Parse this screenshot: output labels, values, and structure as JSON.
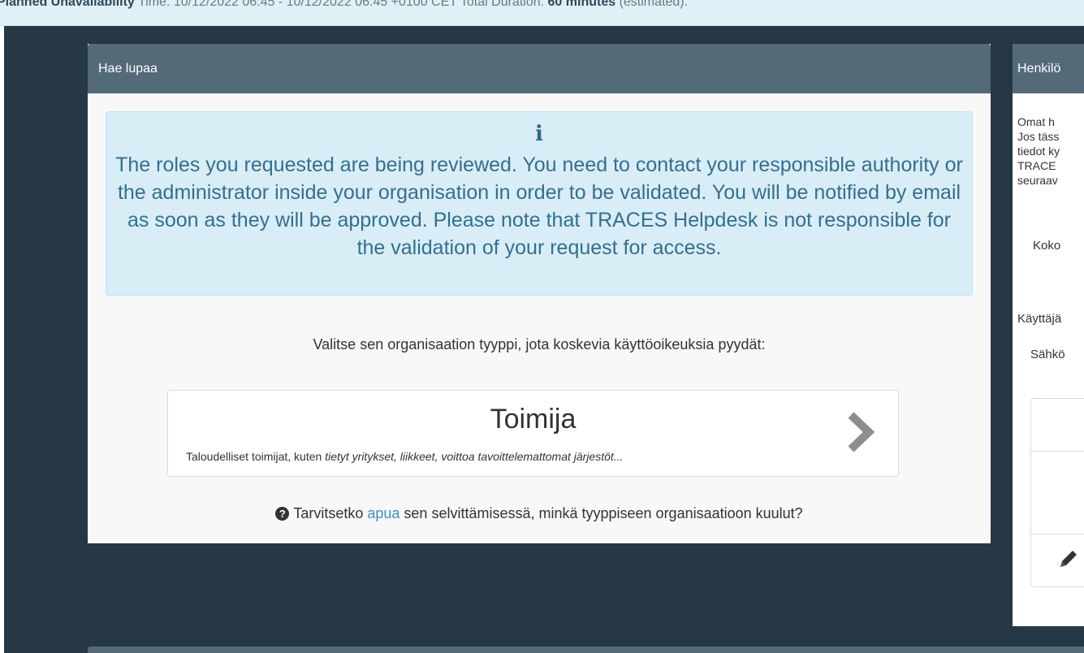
{
  "banner": {
    "title": "Planned Unavailability",
    "time_label": "Time:",
    "time_start": "10/12/2022 06:45",
    "dash": "-",
    "time_end": "10/12/2022 06:45",
    "tz": "+0100 CET",
    "duration_label": "Total Duration:",
    "duration_value": "60 minutes",
    "duration_note": "(estimated)."
  },
  "panel": {
    "title": "Hae lupaa",
    "alert_icon": "info-icon",
    "alert_text": "The roles you requested are being reviewed. You need to contact your responsible authority or the administrator inside your organisation in order to be validated. You will be notified by email as soon as they will be approved. Please note that TRACES Helpdesk is not responsible for the validation of your request for access.",
    "prompt": "Valitse sen organisaation tyyppi, jota koskevia käyttöoikeuksia pyydät:",
    "org": {
      "title": "Toimija",
      "desc_prefix": "Taloudelliset toimijat, kuten ",
      "desc_examples": "tietyt yritykset, liikkeet, voittoa tavoittelemattomat järjestöt...",
      "icon": "chevron-right-icon"
    },
    "help": {
      "icon": "question-circle-icon",
      "before": "Tarvitsetko",
      "link": "apua",
      "after": "sen selvittämisessä, minkä tyyppiseen organisaatioon kuulut?"
    }
  },
  "right_panel": {
    "title": "Henkilö",
    "lines": [
      "Omat h",
      "Jos täss",
      "tiedot ky",
      "TRACE",
      "seuraav"
    ],
    "koko": "Koko",
    "kayttaja": "Käyttäjä",
    "sahko": "Sähkö",
    "edit_icon": "pencil-icon"
  },
  "colors": {
    "page_bg": "#263845",
    "panel_header": "#536a77",
    "alert_bg": "#d9edf7",
    "alert_text": "#31708f",
    "link": "#3a8fc9"
  }
}
